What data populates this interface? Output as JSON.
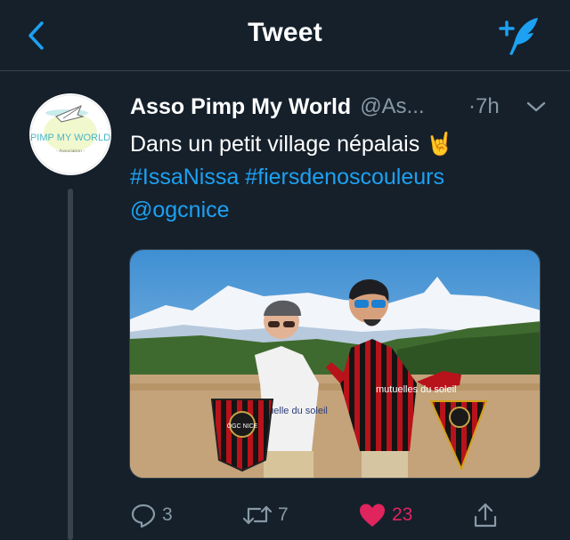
{
  "header": {
    "title": "Tweet",
    "back_icon": "chevron-left-icon",
    "compose_icon": "compose-tweet-icon",
    "accent_color": "#1da1f2"
  },
  "tweet": {
    "author_name": "Asso Pimp My World",
    "author_handle": "@As...",
    "time": "·7h",
    "avatar_logo_text": "PIMP MY WORLD",
    "avatar_logo_subtext": "- Association -",
    "text_line": "Dans un petit village népalais",
    "emoji": "🤘",
    "hashtags": [
      "#IssaNissa",
      "#fiersdenoscouleurs"
    ],
    "mention": "@ogcnice",
    "photo": {
      "jersey_text_left": "utuelle du soleil",
      "jersey_text_right": "mutuelles du soleil",
      "pennant_text": "OGC NICE"
    }
  },
  "actions": {
    "reply_count": "3",
    "retweet_count": "7",
    "like_count": "23",
    "like_color": "#e0245e"
  }
}
